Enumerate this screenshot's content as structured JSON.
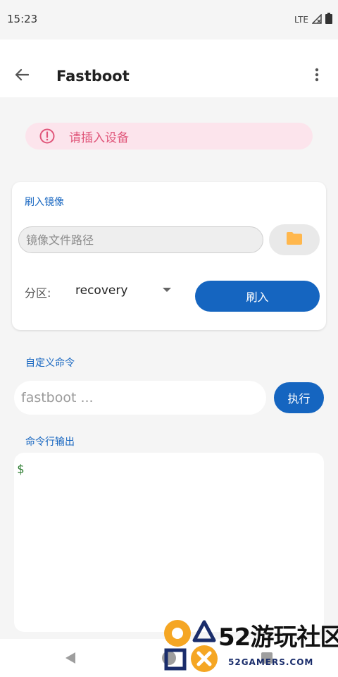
{
  "status_bar": {
    "time": "15:23",
    "network": "LTE"
  },
  "app_bar": {
    "title": "Fastboot",
    "back_icon": "arrow-left-icon",
    "menu_icon": "more-vertical-icon"
  },
  "alert": {
    "text": "请插入设备",
    "icon": "alert-circle-icon",
    "color": "#e0567a",
    "background": "#fce4ec"
  },
  "flash_card": {
    "title": "刷入镜像",
    "path_placeholder": "镜像文件路径",
    "path_value": "",
    "folder_icon": "folder-icon",
    "partition_label": "分区:",
    "partition_value": "recovery",
    "flash_button": "刷入"
  },
  "custom_command": {
    "label": "自定义命令",
    "placeholder": "fastboot ...",
    "value": "",
    "execute_button": "执行"
  },
  "output": {
    "label": "命令行输出",
    "prompt": "$"
  },
  "watermark": {
    "title": "52游玩社区",
    "domain": "52GAMERS.COM"
  },
  "colors": {
    "primary": "#1565c0",
    "prompt": "#2e7d32",
    "folder": "#ffb74d"
  }
}
